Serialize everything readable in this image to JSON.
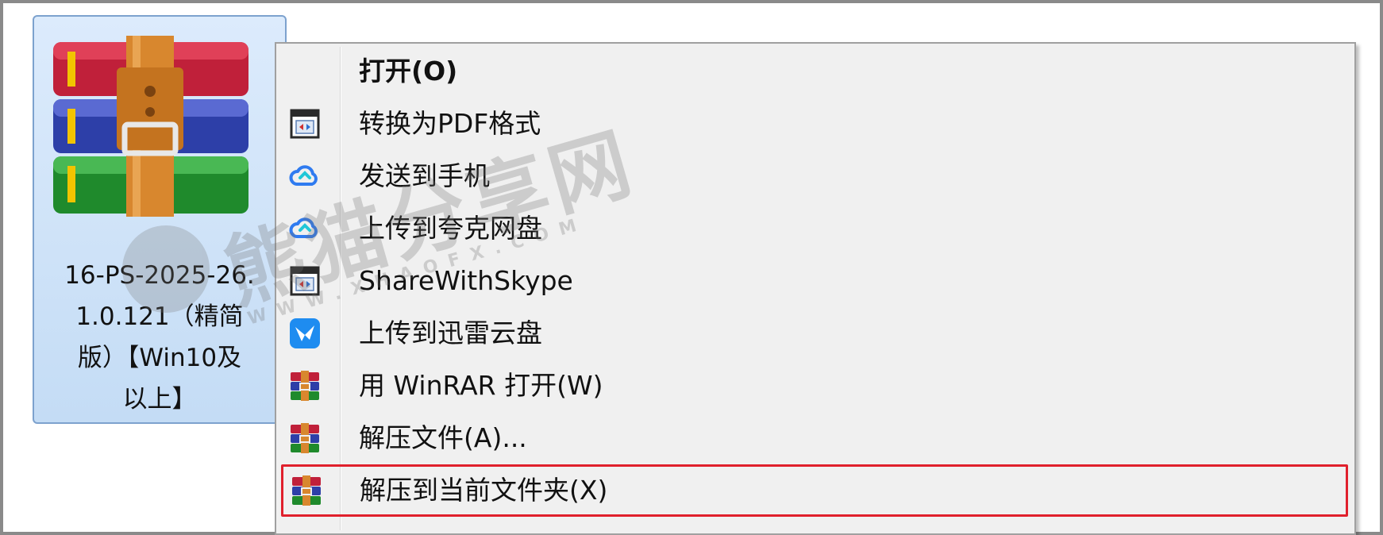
{
  "file": {
    "name_lines": [
      "16-PS-2025-26.",
      "1.0.121（精简",
      "版）【Win10及",
      "以上】"
    ],
    "icon": "winrar-archive-icon"
  },
  "context_menu": {
    "items": [
      {
        "label": "打开(O)",
        "icon": "",
        "bold": true
      },
      {
        "label": "转换为PDF格式",
        "icon": "pdf-convert-icon"
      },
      {
        "label": "发送到手机",
        "icon": "cloud-blue-icon"
      },
      {
        "label": "上传到夸克网盘",
        "icon": "cloud-blue-icon"
      },
      {
        "label": "ShareWithSkype",
        "icon": "app-window-icon"
      },
      {
        "label": "上传到迅雷云盘",
        "icon": "thunder-bird-icon"
      },
      {
        "label": "用 WinRAR 打开(W)",
        "icon": "winrar-icon"
      },
      {
        "label": "解压文件(A)...",
        "icon": "winrar-icon"
      },
      {
        "label": "解压到当前文件夹(X)",
        "icon": "winrar-icon",
        "highlighted": true
      }
    ]
  },
  "watermark": {
    "text": "熊猫分享网",
    "url_text": "WWW.XHAOFX.COM"
  },
  "colors": {
    "selection_bg": "#c4dcf5",
    "selection_border": "#7da2ce",
    "menu_bg": "#f0f0f0",
    "highlight_border": "#e0202c"
  }
}
